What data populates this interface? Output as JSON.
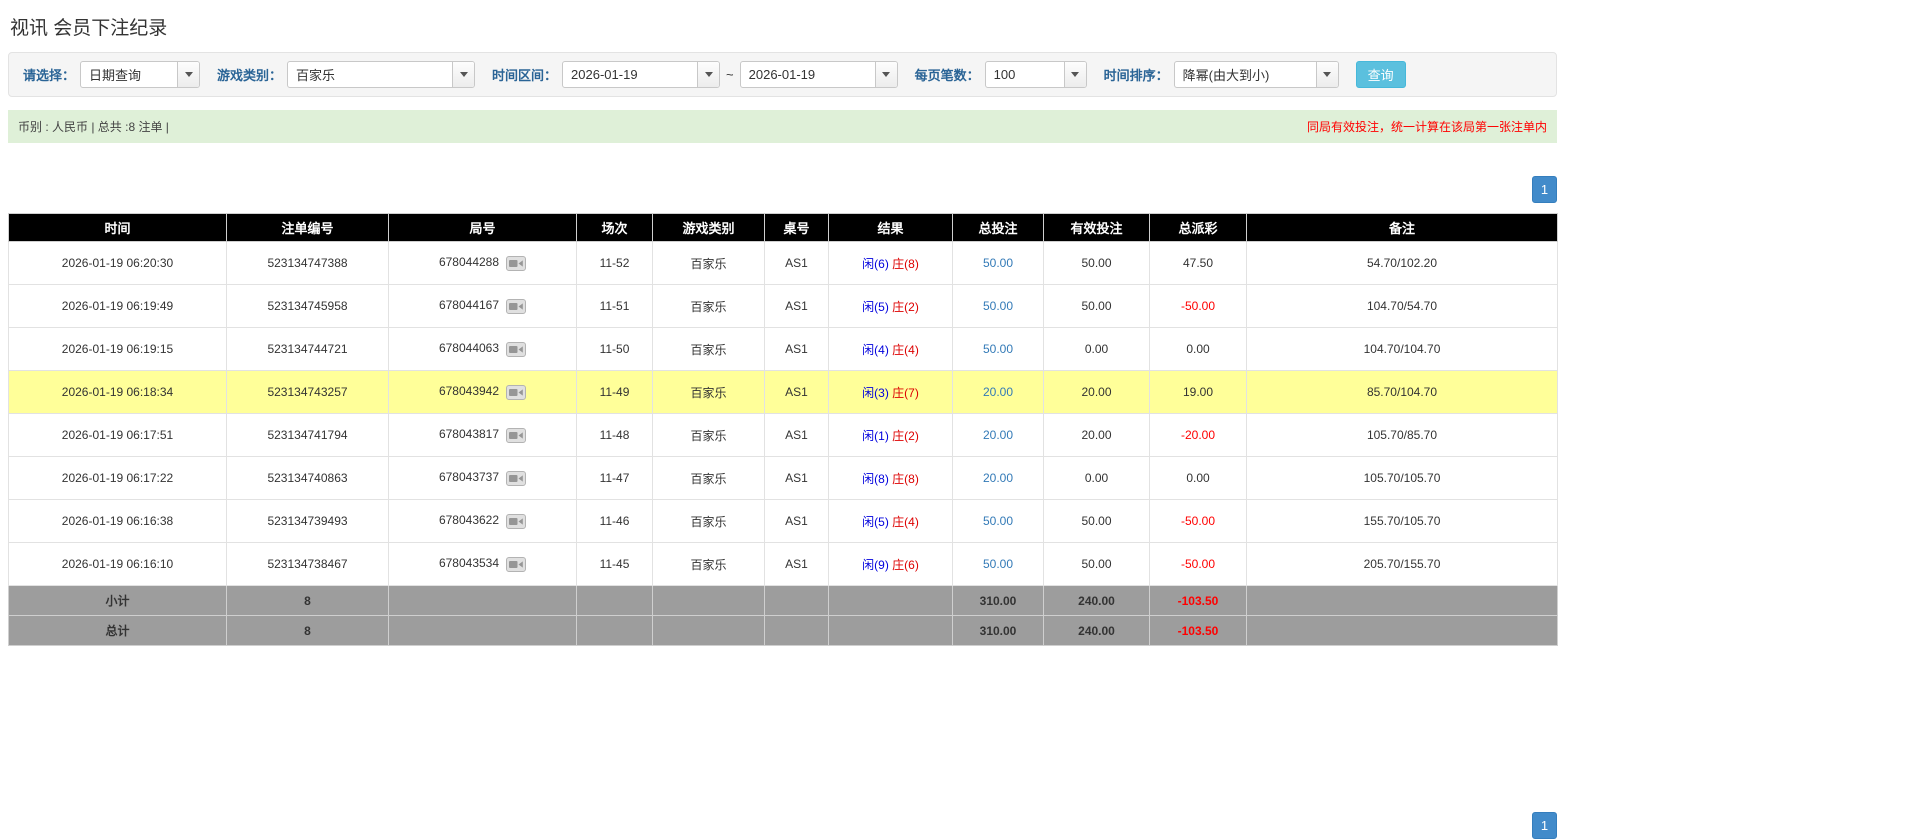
{
  "page": {
    "title": "视讯 会员下注纪录"
  },
  "filters": {
    "select_label": "请选择：",
    "select_value": "日期查询",
    "game_type_label": "游戏类别：",
    "game_type_value": "百家乐",
    "time_range_label": "时间区间：",
    "date_from": "2026-01-19",
    "date_separator": "~",
    "date_to": "2026-01-19",
    "page_size_label": "每页笔数：",
    "page_size_value": "100",
    "sort_label": "时间排序：",
    "sort_value": "降幂(由大到小)",
    "query_button": "查询"
  },
  "summary": {
    "left_text": "币别 : 人民币 | 总共 :8 注单 |",
    "right_text": "同局有效投注，统一计算在该局第一张注单内"
  },
  "pagination": {
    "page": "1"
  },
  "table": {
    "headers": [
      "时间",
      "注单编号",
      "局号",
      "场次",
      "游戏类别",
      "桌号",
      "结果",
      "总投注",
      "有效投注",
      "总派彩",
      "备注"
    ],
    "rows": [
      {
        "time": "2026-01-19 06:20:30",
        "bet_id": "523134747388",
        "round_id": "678044288",
        "session": "11-52",
        "game": "百家乐",
        "table_no": "AS1",
        "result_player": "闲(6)",
        "result_banker": "庄(8)",
        "total_bet": "50.00",
        "valid_bet": "50.00",
        "payout": "47.50",
        "remark": "54.70/102.20",
        "highlight": false
      },
      {
        "time": "2026-01-19 06:19:49",
        "bet_id": "523134745958",
        "round_id": "678044167",
        "session": "11-51",
        "game": "百家乐",
        "table_no": "AS1",
        "result_player": "闲(5)",
        "result_banker": "庄(2)",
        "total_bet": "50.00",
        "valid_bet": "50.00",
        "payout": "-50.00",
        "remark": "104.70/54.70",
        "highlight": false
      },
      {
        "time": "2026-01-19 06:19:15",
        "bet_id": "523134744721",
        "round_id": "678044063",
        "session": "11-50",
        "game": "百家乐",
        "table_no": "AS1",
        "result_player": "闲(4)",
        "result_banker": "庄(4)",
        "total_bet": "50.00",
        "valid_bet": "0.00",
        "payout": "0.00",
        "remark": "104.70/104.70",
        "highlight": false
      },
      {
        "time": "2026-01-19 06:18:34",
        "bet_id": "523134743257",
        "round_id": "678043942",
        "session": "11-49",
        "game": "百家乐",
        "table_no": "AS1",
        "result_player": "闲(3)",
        "result_banker": "庄(7)",
        "total_bet": "20.00",
        "valid_bet": "20.00",
        "payout": "19.00",
        "remark": "85.70/104.70",
        "highlight": true
      },
      {
        "time": "2026-01-19 06:17:51",
        "bet_id": "523134741794",
        "round_id": "678043817",
        "session": "11-48",
        "game": "百家乐",
        "table_no": "AS1",
        "result_player": "闲(1)",
        "result_banker": "庄(2)",
        "total_bet": "20.00",
        "valid_bet": "20.00",
        "payout": "-20.00",
        "remark": "105.70/85.70",
        "highlight": false
      },
      {
        "time": "2026-01-19 06:17:22",
        "bet_id": "523134740863",
        "round_id": "678043737",
        "session": "11-47",
        "game": "百家乐",
        "table_no": "AS1",
        "result_player": "闲(8)",
        "result_banker": "庄(8)",
        "total_bet": "20.00",
        "valid_bet": "0.00",
        "payout": "0.00",
        "remark": "105.70/105.70",
        "highlight": false
      },
      {
        "time": "2026-01-19 06:16:38",
        "bet_id": "523134739493",
        "round_id": "678043622",
        "session": "11-46",
        "game": "百家乐",
        "table_no": "AS1",
        "result_player": "闲(5)",
        "result_banker": "庄(4)",
        "total_bet": "50.00",
        "valid_bet": "50.00",
        "payout": "-50.00",
        "remark": "155.70/105.70",
        "highlight": false
      },
      {
        "time": "2026-01-19 06:16:10",
        "bet_id": "523134738467",
        "round_id": "678043534",
        "session": "11-45",
        "game": "百家乐",
        "table_no": "AS1",
        "result_player": "闲(9)",
        "result_banker": "庄(6)",
        "total_bet": "50.00",
        "valid_bet": "50.00",
        "payout": "-50.00",
        "remark": "205.70/155.70",
        "highlight": false
      }
    ],
    "subtotal": {
      "label": "小计",
      "count": "8",
      "total_bet": "310.00",
      "valid_bet": "240.00",
      "payout": "-103.50"
    },
    "total": {
      "label": "总计",
      "count": "8",
      "total_bet": "310.00",
      "valid_bet": "240.00",
      "payout": "-103.50"
    }
  }
}
